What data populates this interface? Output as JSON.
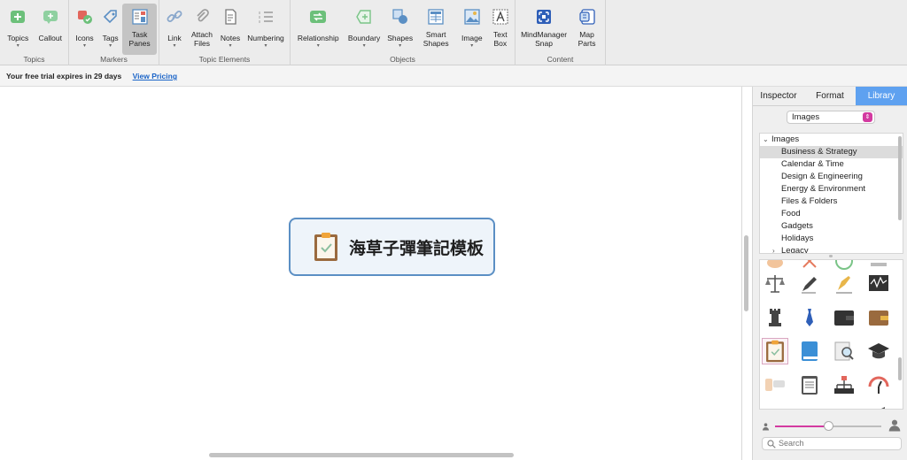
{
  "ribbon": {
    "groups": [
      {
        "label": "Topics",
        "buttons": [
          {
            "label": "Topics"
          },
          {
            "label": "Callout"
          }
        ]
      },
      {
        "label": "Markers",
        "buttons": [
          {
            "label": "Icons"
          },
          {
            "label": "Tags"
          },
          {
            "label": "Task\nPanes"
          }
        ]
      },
      {
        "label": "Topic Elements",
        "buttons": [
          {
            "label": "Link"
          },
          {
            "label": "Attach\nFiles"
          },
          {
            "label": "Notes"
          },
          {
            "label": "Numbering"
          }
        ]
      },
      {
        "label": "Objects",
        "buttons": [
          {
            "label": "Relationship"
          },
          {
            "label": "Boundary"
          },
          {
            "label": "Shapes"
          },
          {
            "label": "Smart\nShapes"
          },
          {
            "label": "Image"
          },
          {
            "label": "Text\nBox"
          }
        ]
      },
      {
        "label": "Content",
        "buttons": [
          {
            "label": "MindManager\nSnap"
          },
          {
            "label": "Map\nParts"
          }
        ]
      }
    ]
  },
  "trial": {
    "message": "Your free trial expires in 29 days",
    "link": "View Pricing"
  },
  "topic": {
    "title": "海草子彈筆記模板"
  },
  "pane": {
    "tabs": [
      "Inspector",
      "Format",
      "Library"
    ],
    "selector_value": "Images",
    "tree": {
      "root": "Images",
      "items": [
        "Business & Strategy",
        "Calendar & Time",
        "Design & Engineering",
        "Energy & Environment",
        "Files & Folders",
        "Food",
        "Gadgets",
        "Holidays",
        "Legacy"
      ]
    },
    "search_placeholder": "Search",
    "icon_size_level": 0.5
  },
  "colors": {
    "accent": "#5ea1f0",
    "topic_border": "#5b8fc4",
    "link": "#1a64c8",
    "slider": "#d33aa0"
  }
}
